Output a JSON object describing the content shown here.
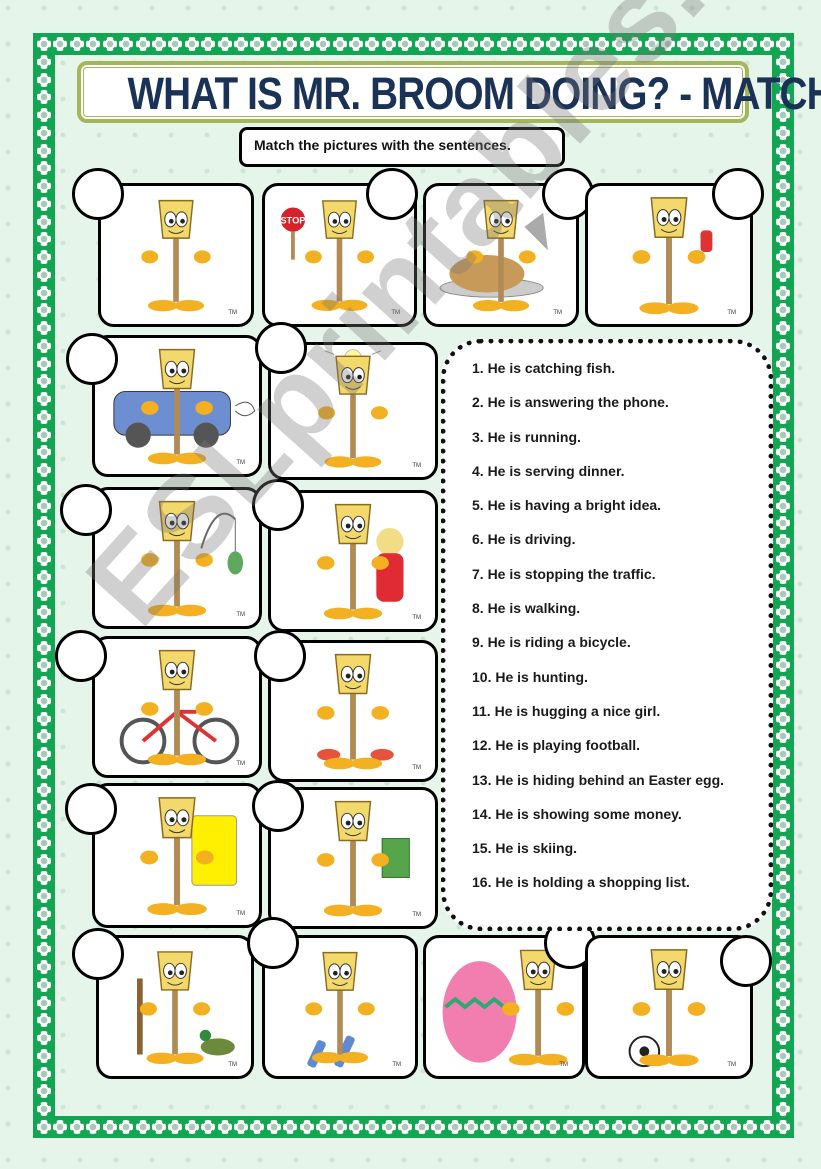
{
  "title": "WHAT IS MR. BROOM DOING? - MATCHING",
  "instruction": "Match the pictures with the sentences.",
  "watermark": "ESLprintables.com",
  "colors": {
    "frame_green": "#12a552",
    "title_navy": "#1b3257",
    "title_border": "#a3b65b",
    "page_bg": "#e6f5ea"
  },
  "pictures": [
    {
      "scene": "running",
      "icon": "broom-running-icon"
    },
    {
      "scene": "stopping traffic",
      "icon": "broom-stop-sign-icon",
      "sign_text": "STOP"
    },
    {
      "scene": "serving dinner",
      "icon": "broom-turkey-icon"
    },
    {
      "scene": "answering the phone",
      "icon": "broom-phone-icon"
    },
    {
      "scene": "driving",
      "icon": "broom-car-icon"
    },
    {
      "scene": "bright idea",
      "icon": "broom-lightbulb-icon"
    },
    {
      "scene": "catching fish",
      "icon": "broom-fishing-icon"
    },
    {
      "scene": "hugging a nice girl",
      "icon": "broom-girl-icon"
    },
    {
      "scene": "riding a bicycle",
      "icon": "broom-bicycle-icon"
    },
    {
      "scene": "walking",
      "icon": "broom-walking-icon"
    },
    {
      "scene": "holding a shopping list",
      "icon": "broom-list-icon"
    },
    {
      "scene": "showing money",
      "icon": "broom-money-icon"
    },
    {
      "scene": "hunting",
      "icon": "broom-hunting-icon"
    },
    {
      "scene": "skiing",
      "icon": "broom-skiing-icon"
    },
    {
      "scene": "hiding behind an Easter egg",
      "icon": "broom-easter-egg-icon"
    },
    {
      "scene": "playing football",
      "icon": "broom-football-icon"
    }
  ],
  "sentences": [
    "1. He is catching fish.",
    "2. He is answering the phone.",
    "3. He is running.",
    "4. He is serving dinner.",
    "5. He is having a bright idea.",
    "6. He is driving.",
    "7. He is stopping the traffic.",
    "8. He is walking.",
    "9. He is riding a bicycle.",
    "10. He is hunting.",
    "11. He is hugging a nice girl.",
    "12. He is playing football.",
    "13. He is hiding behind an Easter egg.",
    "14. He is showing some money.",
    "15. He is skiing.",
    "16. He is holding a shopping list."
  ],
  "tm_mark": "TM"
}
